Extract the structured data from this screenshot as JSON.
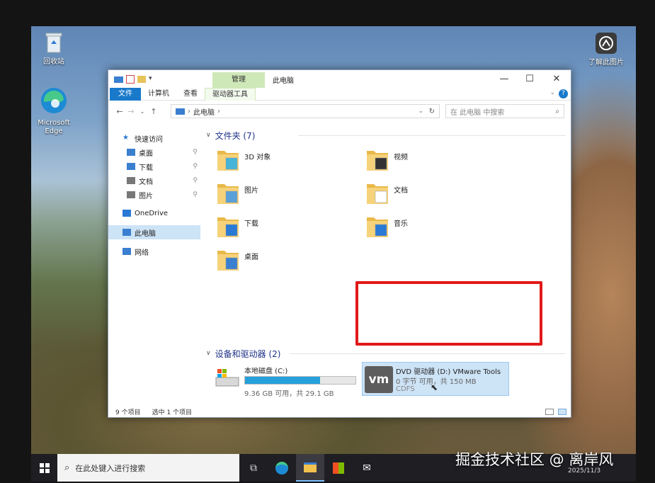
{
  "desktop": {
    "icons": [
      {
        "label": "回收站",
        "icon": "recycle-bin-icon"
      },
      {
        "label": "Microsoft Edge",
        "icon": "edge-icon"
      },
      {
        "label": "了解此图片",
        "icon": "camera-info-icon"
      }
    ]
  },
  "window": {
    "title": "此电脑",
    "context_tab": "管理",
    "ribbon_tabs": [
      "文件",
      "计算机",
      "查看",
      "驱动器工具"
    ],
    "controls": {
      "minimize": "—",
      "maximize": "☐",
      "close": "✕"
    }
  },
  "address": {
    "path": "此电脑",
    "search_placeholder": "在 此电脑 中搜索"
  },
  "nav_pane": {
    "items": [
      {
        "label": "快速访问",
        "pinned": false
      },
      {
        "label": "桌面",
        "pinned": true
      },
      {
        "label": "下载",
        "pinned": true
      },
      {
        "label": "文档",
        "pinned": true
      },
      {
        "label": "图片",
        "pinned": true
      },
      {
        "label": "OneDrive",
        "pinned": false
      },
      {
        "label": "此电脑",
        "pinned": false,
        "selected": true
      },
      {
        "label": "网络",
        "pinned": false
      }
    ]
  },
  "content": {
    "folders_header": "文件夹 (7)",
    "folders": [
      "3D 对象",
      "视频",
      "图片",
      "文档",
      "下载",
      "音乐",
      "桌面"
    ],
    "drives_header": "设备和驱动器 (2)",
    "drives": [
      {
        "name": "本地磁盘 (C:)",
        "space": "9.36 GB 可用，共 29.1 GB",
        "used_fraction": 0.68,
        "selected": false
      },
      {
        "name": "DVD 驱动器 (D:) VMware Tools",
        "space": "0 字节 可用，共 150 MB",
        "fs": "CDFS",
        "selected": true,
        "logo": "vm"
      }
    ]
  },
  "status": {
    "item_count": "9 个项目",
    "selected": "选中 1 个项目"
  },
  "taskbar": {
    "search_placeholder": "在此处键入进行搜索",
    "clock_date": "2025/11/3"
  },
  "watermark": "掘金技术社区 @ 离岸风",
  "colors": {
    "accent": "#1979ca",
    "selection": "#cde3f6",
    "highlight_box": "#e11919",
    "context_tab": "#cfe8b8"
  }
}
